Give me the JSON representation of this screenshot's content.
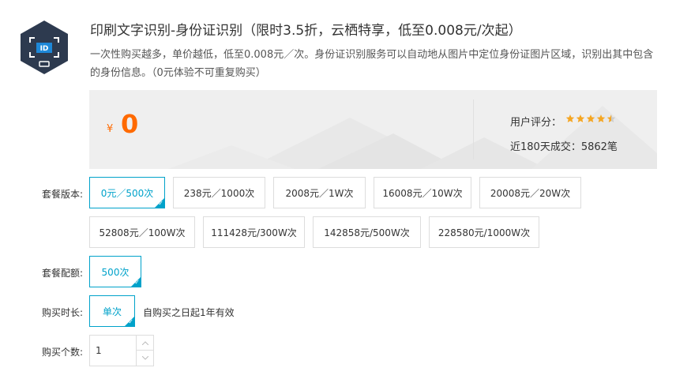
{
  "product": {
    "title": "印刷文字识别-身份证识别（限时3.5折，云栖特享，低至0.008元/次起）",
    "description": "一次性购买越多，单价越低，低至0.008元／次。身份证识别服务可以自动地从图片中定位身份证图片区域，识别出其中包含的身份信息。（0元体验不可重复购买）",
    "logo_icon": "id-card-scan-icon",
    "logo_text": "ID"
  },
  "pricing": {
    "currency_symbol": "¥",
    "price": "0",
    "rating_label": "用户评分：",
    "rating_stars": 4.5,
    "deals_text": "近180天成交：5862笔"
  },
  "version": {
    "label": "套餐版本:",
    "options": [
      "0元／500次",
      "238元／1000次",
      "2008元／1W次",
      "16008元／10W次",
      "20008元／20W次",
      "52808元／100W次",
      "111428元/300W次",
      "142858元/500W次",
      "228580元/1000W次"
    ],
    "selected_index": 0
  },
  "quota": {
    "label": "套餐配额:",
    "options": [
      "500次"
    ]
  },
  "duration": {
    "label": "购买时长:",
    "options": [
      "单次"
    ],
    "validity": "自购买之日起1年有效"
  },
  "quantity": {
    "label": "购买个数:",
    "value": "1"
  },
  "colors": {
    "accent": "#00a2ca",
    "price": "#ff6a00",
    "star": "#f5a623",
    "logo_bg": "#2d3a4f"
  }
}
